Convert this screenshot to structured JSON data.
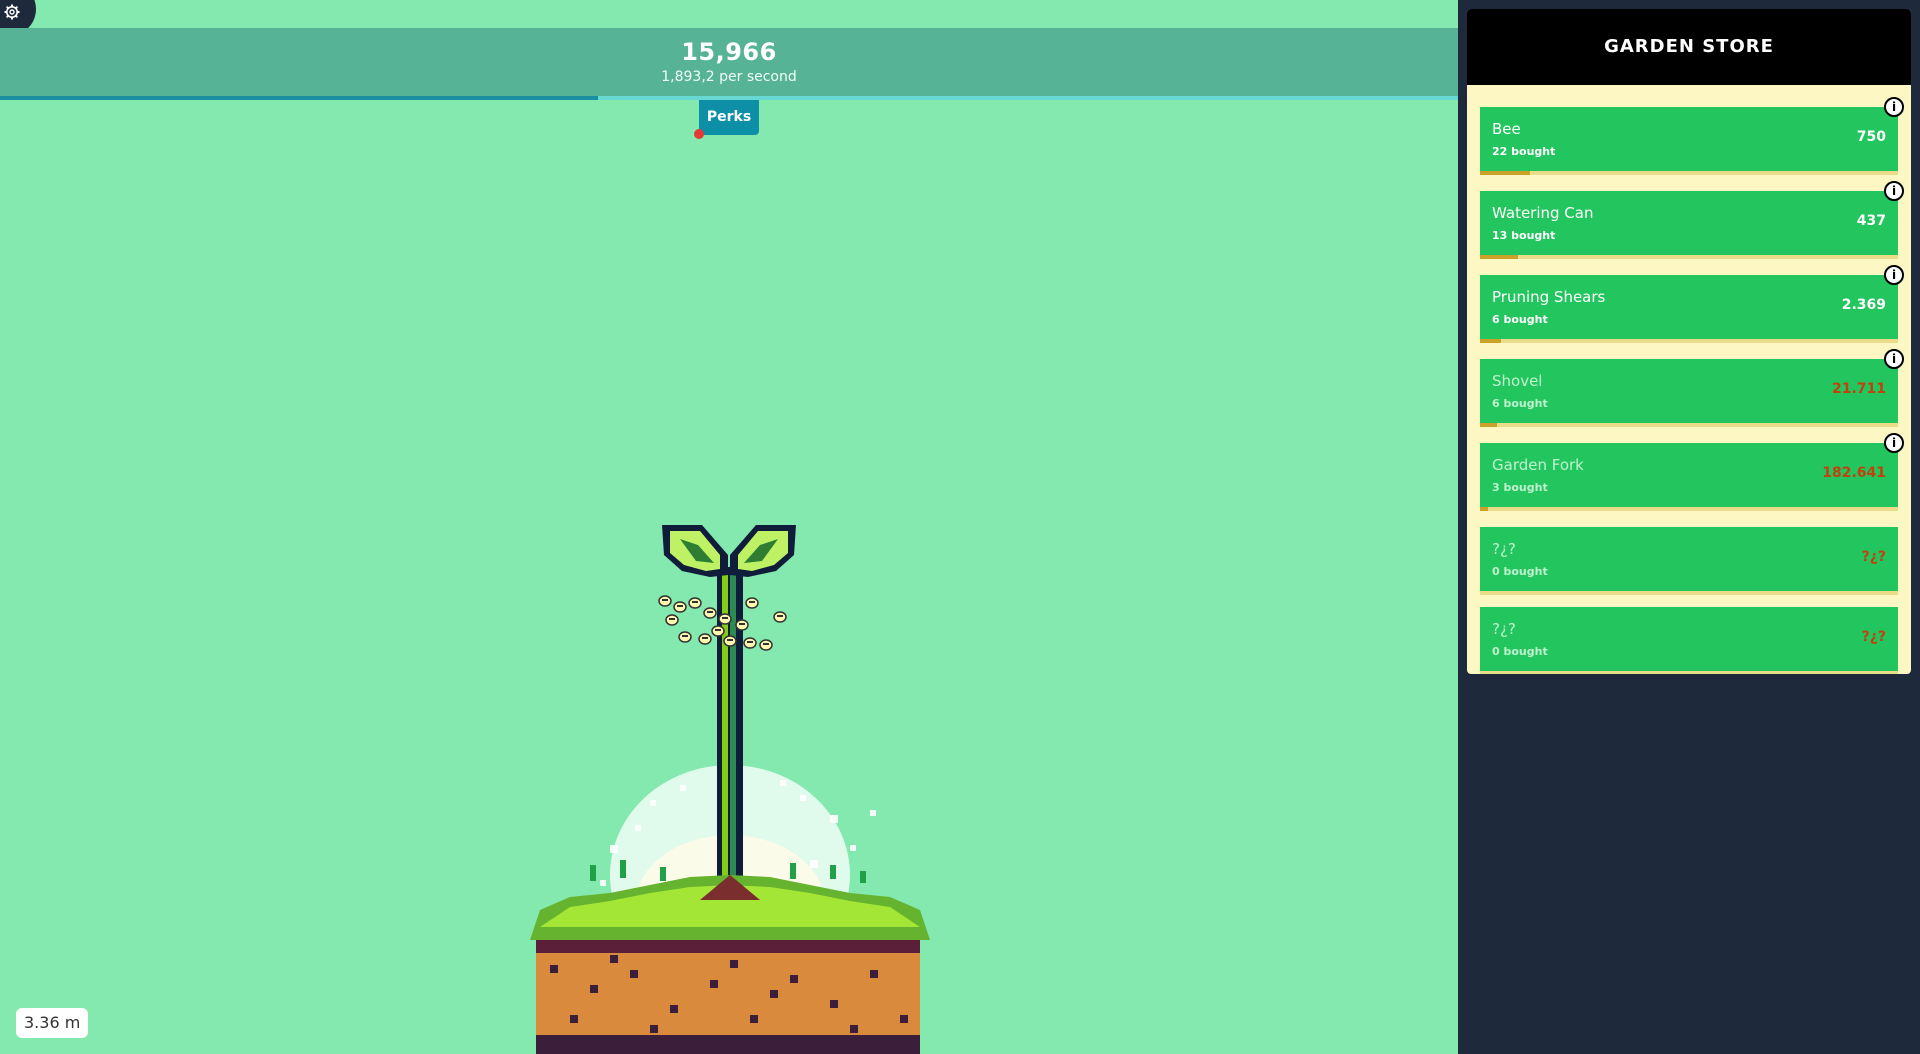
{
  "score": {
    "value": "15,966",
    "rate": "1,893,2 per second",
    "progress_fraction": 0.41
  },
  "perks": {
    "label": "Perks"
  },
  "height": {
    "label": "3.36 m"
  },
  "store": {
    "title": "GARDEN STORE",
    "items": [
      {
        "name": "Bee",
        "count": "22 bought",
        "price": "750",
        "locked": false,
        "progress": 0.12
      },
      {
        "name": "Watering Can",
        "count": "13 bought",
        "price": "437",
        "locked": false,
        "progress": 0.09
      },
      {
        "name": "Pruning Shears",
        "count": "6 bought",
        "price": "2.369",
        "locked": false,
        "progress": 0.05
      },
      {
        "name": "Shovel",
        "count": "6 bought",
        "price": "21.711",
        "locked": true,
        "progress": 0.04
      },
      {
        "name": "Garden Fork",
        "count": "3 bought",
        "price": "182.641",
        "locked": true,
        "progress": 0.02
      },
      {
        "name": "?¿?",
        "count": "0 bought",
        "price": "?¿?",
        "locked": true,
        "progress": 0
      },
      {
        "name": "?¿?",
        "count": "0 bought",
        "price": "?¿?",
        "locked": true,
        "progress": 0
      }
    ]
  },
  "icons": {
    "settings": "gear-icon",
    "info": "info-icon"
  },
  "colors": {
    "background": "#84e9ae",
    "store_item": "#22c55e",
    "sidebar": "#1e293b",
    "perks": "#0e8fa8"
  }
}
